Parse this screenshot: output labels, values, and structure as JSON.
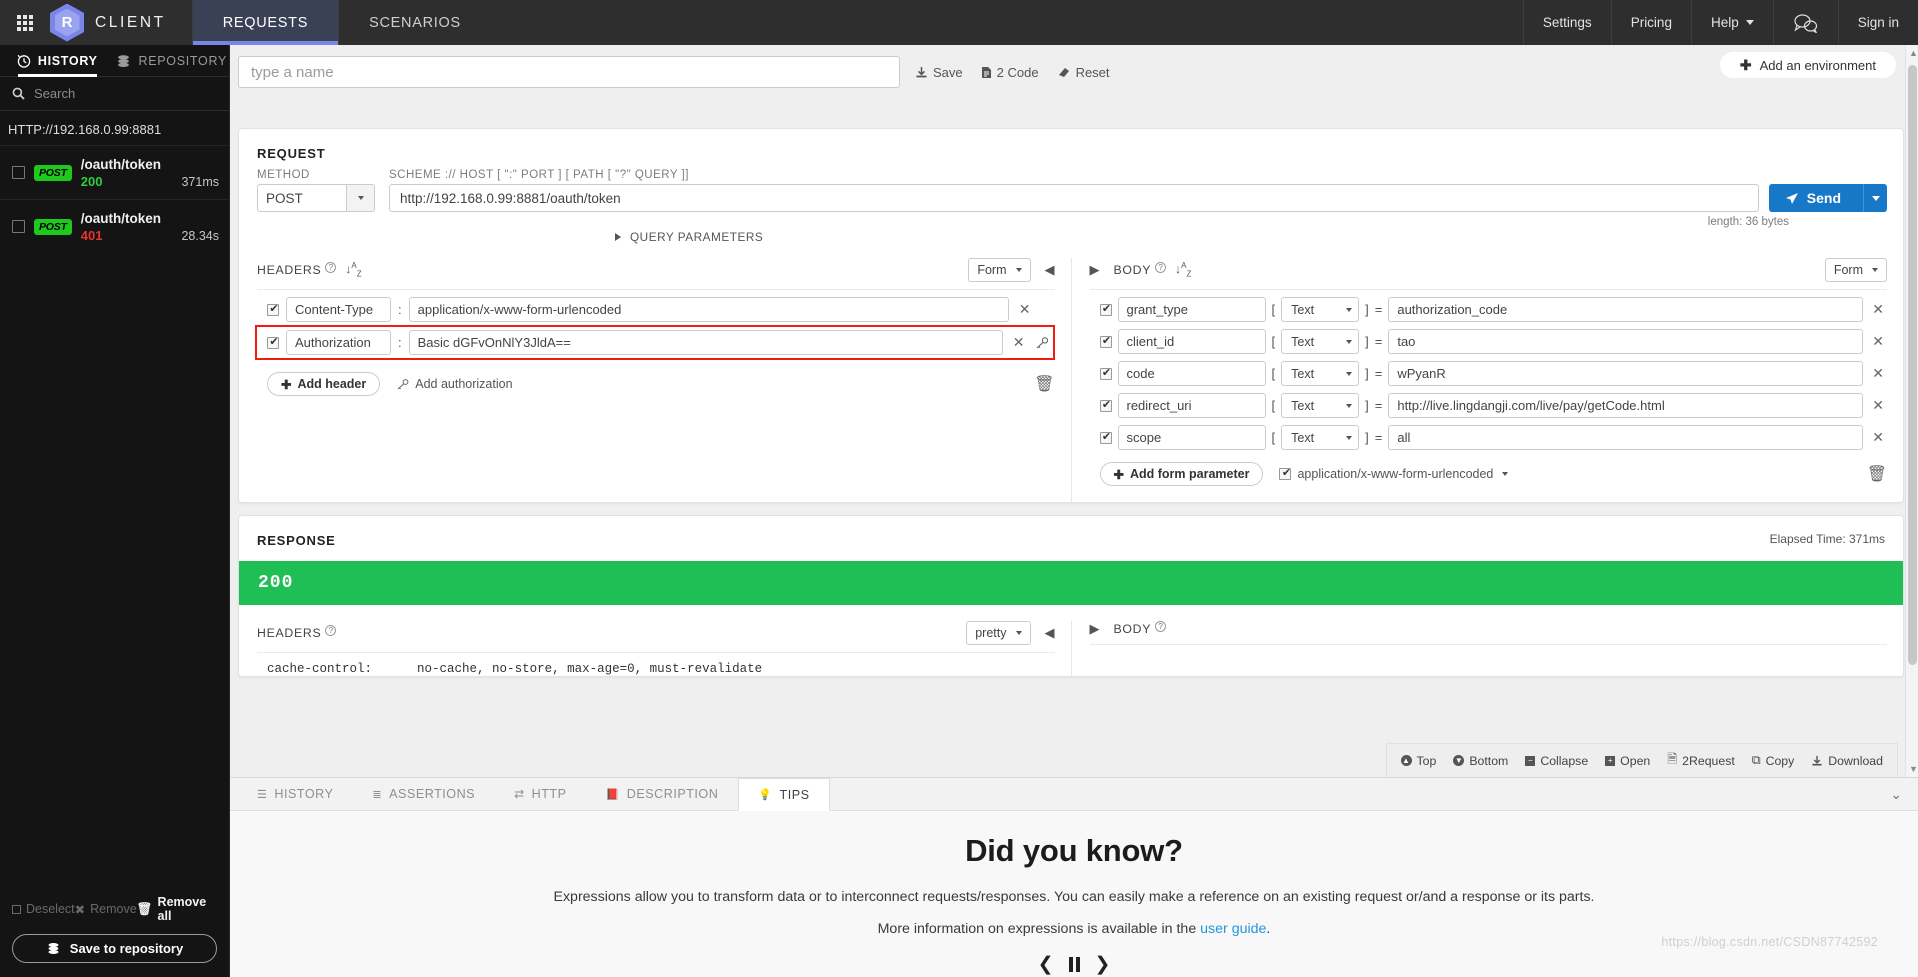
{
  "topnav": {
    "brand": "CLIENT",
    "logo_letter": "R",
    "tabs": [
      {
        "label": "REQUESTS",
        "active": true
      },
      {
        "label": "SCENARIOS",
        "active": false
      }
    ],
    "right_items": [
      {
        "label": "Settings"
      },
      {
        "label": "Pricing"
      },
      {
        "label": "Help"
      },
      {
        "label": "Sign in"
      }
    ],
    "chat_icon": "chat-bubbles-icon"
  },
  "sidebar": {
    "tabs": [
      {
        "label": "HISTORY",
        "icon": "clock-icon",
        "active": true
      },
      {
        "label": "REPOSITORY",
        "icon": "database-icon",
        "active": false
      }
    ],
    "search_placeholder": "Search",
    "host_group": "HTTP://192.168.0.99:8881",
    "history": [
      {
        "method": "POST",
        "path": "/oauth/token",
        "status": "200",
        "status_class": "ok",
        "time": "371ms"
      },
      {
        "method": "POST",
        "path": "/oauth/token",
        "status": "401",
        "status_class": "err",
        "time": "28.34s"
      }
    ],
    "footer": {
      "deselect": "Deselect",
      "remove": "Remove",
      "remove_all": "Remove all",
      "save_to_repository": "Save to repository"
    }
  },
  "topbar": {
    "name_placeholder": "type a name",
    "name_value": "",
    "actions": [
      {
        "label": "Save",
        "icon": "save-icon"
      },
      {
        "label": "2 Code",
        "icon": "code-file-icon"
      },
      {
        "label": "Reset",
        "icon": "eraser-icon"
      }
    ],
    "add_environment": "Add an environment"
  },
  "request": {
    "title": "REQUEST",
    "method_label": "METHOD",
    "method_value": "POST",
    "url_label": "SCHEME :// HOST [ \":\" PORT ] [ PATH [ \"?\" QUERY ]]",
    "url_value": "http://192.168.0.99:8881/oauth/token",
    "send_label": "Send",
    "length_note": "length: 36 bytes",
    "query_parameters": "QUERY PARAMETERS",
    "headers": {
      "title": "HEADERS",
      "mode": "Form",
      "rows": [
        {
          "checked": true,
          "key": "Content-Type",
          "value": "application/x-www-form-urlencoded",
          "highlight": false,
          "has_key_icon": false
        },
        {
          "checked": true,
          "key": "Authorization",
          "value": "Basic dGFvOnNlY3JldA==",
          "highlight": true,
          "has_key_icon": true
        }
      ],
      "add_header": "Add header",
      "add_authorization": "Add authorization"
    },
    "body": {
      "title": "BODY",
      "mode": "Form",
      "rows": [
        {
          "checked": true,
          "key": "grant_type",
          "type": "Text",
          "value": "authorization_code"
        },
        {
          "checked": true,
          "key": "client_id",
          "type": "Text",
          "value": "tao"
        },
        {
          "checked": true,
          "key": "code",
          "type": "Text",
          "value": "wPyanR"
        },
        {
          "checked": true,
          "key": "redirect_uri",
          "type": "Text",
          "value": "http://live.lingdangji.com/live/pay/getCode.html"
        },
        {
          "checked": true,
          "key": "scope",
          "type": "Text",
          "value": "all"
        }
      ],
      "add_form_parameter": "Add form parameter",
      "content_type": "application/x-www-form-urlencoded",
      "content_type_checked": true
    }
  },
  "response": {
    "title": "RESPONSE",
    "elapsed": "Elapsed Time: 371ms",
    "status_code": "200",
    "headers": {
      "title": "HEADERS",
      "mode": "pretty",
      "first_line_name": "cache-control:",
      "first_line_value": "no-cache, no-store, max-age=0, must-revalidate"
    },
    "body": {
      "title": "BODY"
    },
    "toolbar": [
      {
        "label": "Top",
        "icon": "arrow-up-circle-icon"
      },
      {
        "label": "Bottom",
        "icon": "arrow-down-circle-icon"
      },
      {
        "label": "Collapse",
        "icon": "minus-square-icon"
      },
      {
        "label": "Open",
        "icon": "plus-square-icon"
      },
      {
        "label": "2Request",
        "icon": "copy-to-request-icon"
      },
      {
        "label": "Copy",
        "icon": "copy-icon"
      },
      {
        "label": "Download",
        "icon": "download-icon"
      }
    ]
  },
  "bottom": {
    "tabs": [
      {
        "label": "HISTORY",
        "icon": "list-icon",
        "active": false
      },
      {
        "label": "ASSERTIONS",
        "icon": "assertions-icon",
        "active": false
      },
      {
        "label": "HTTP",
        "icon": "exchange-icon",
        "active": false
      },
      {
        "label": "DESCRIPTION",
        "icon": "book-icon",
        "active": false
      },
      {
        "label": "TIPS",
        "icon": "lightbulb-icon",
        "active": true
      }
    ],
    "tips": {
      "heading": "Did you know?",
      "text": "Expressions allow you to transform data or to interconnect requests/responses. You can easily make a reference on an existing request or/and a response or its parts.",
      "more_prefix": "More information on expressions is available in the ",
      "more_link": "user guide",
      "more_suffix": "."
    }
  },
  "watermark": "https://blog.csdn.net/CSDN87742592"
}
